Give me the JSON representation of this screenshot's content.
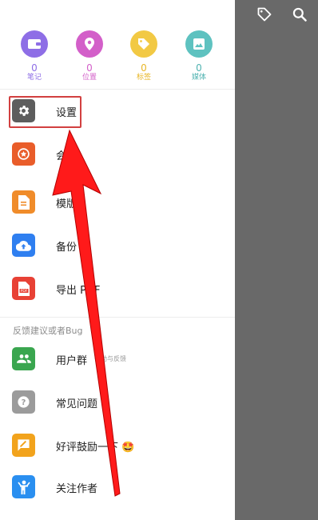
{
  "stats": [
    {
      "count": "0",
      "label": "笔记",
      "color": "#8e6ee6",
      "icon": "folder-icon"
    },
    {
      "count": "0",
      "label": "位置",
      "color": "#d35fc9",
      "icon": "location-pin-icon"
    },
    {
      "count": "0",
      "label": "标签",
      "color": "#f2c944",
      "icon": "tag-icon"
    },
    {
      "count": "0",
      "label": "媒体",
      "color": "#5ec2c0",
      "icon": "image-icon"
    }
  ],
  "menu": {
    "settings": {
      "label": "设置",
      "color": "#5d5d5d",
      "icon": "gear-icon"
    },
    "member": {
      "label": "会",
      "color": "#e95d2a",
      "icon": "star-badge-icon"
    },
    "template": {
      "label": "模版",
      "color": "#f08c2a",
      "icon": "document-icon"
    },
    "backup": {
      "label": "备份",
      "color": "#2f7ff0",
      "icon": "cloud-upload-icon"
    },
    "export_pdf": {
      "label": "导出 PDF",
      "color": "#e84135",
      "icon": "pdf-file-icon"
    }
  },
  "feedback_section": {
    "header": "反馈建议或者Bug",
    "items": {
      "user_group": {
        "label": "用户群",
        "sub": "帮助与反馈",
        "color": "#3aa64f",
        "icon": "group-icon"
      },
      "faq": {
        "label": "常见问题",
        "color": "#9b9b9b",
        "icon": "question-icon"
      },
      "rate": {
        "label": "好评鼓励一下 🤩",
        "color": "#f2a31c",
        "icon": "rating-icon"
      },
      "follow": {
        "label": "关注作者",
        "color": "#2a8ff0",
        "icon": "person-icon"
      }
    }
  },
  "toolbar": {
    "tag_icon": "tag-outline-icon",
    "search_icon": "search-icon"
  },
  "annotation": {
    "arrow_color": "#ff1a1a",
    "highlight_color": "#d24040"
  }
}
